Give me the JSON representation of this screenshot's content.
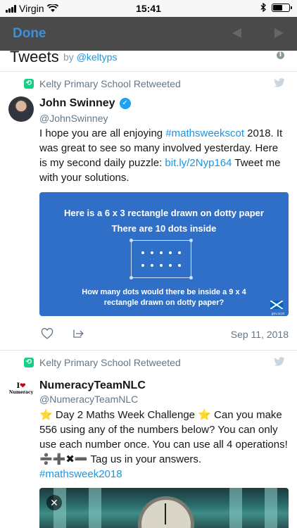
{
  "status_bar": {
    "carrier": "Virgin",
    "time": "15:41",
    "battery_percent": 60
  },
  "nav": {
    "done_label": "Done"
  },
  "widget": {
    "title": "Tweets",
    "by_prefix": "by",
    "by_handle": "@keltyps"
  },
  "tweets": [
    {
      "retweet_label": "Kelty Primary School Retweeted",
      "name": "John Swinney",
      "verified": true,
      "handle": "@JohnSwinney",
      "text_parts": {
        "p1": "I hope you are all enjoying ",
        "hashtag": "#mathsweekscot",
        "p2": " 2018. It was great to see so many involved yesterday. Here is my second daily puzzle: ",
        "link": "bit.ly/2Nyp164",
        "p3": " Tweet me with your solutions."
      },
      "card": {
        "line1": "Here is a 6 x 3 rectangle drawn on dotty paper",
        "line2": "There are 10 dots inside",
        "question1": "How many dots would there be inside a 9 x 4",
        "question2": "rectangle drawn on dotty paper?",
        "flag_label": "gov.scot"
      },
      "date": "Sep 11, 2018"
    },
    {
      "retweet_label": "Kelty Primary School Retweeted",
      "name": "NumeracyTeamNLC",
      "handle": "@NumeracyTeamNLC",
      "avatar_text": {
        "line1": "I",
        "heart": "❤",
        "line2": "Numeracy"
      },
      "text_parts": {
        "star": "⭐",
        "p1": " Day 2 Maths Week Challenge ",
        "p2": " Can you make 556 using any of the numbers below? You can only use each number once. You can use all 4 operations! ",
        "ops": "➗➕✖➖",
        "p3": " Tag us in your answers.",
        "hashtag": "#mathsweek2018"
      },
      "close_label": "✕"
    }
  ],
  "colors": {
    "link": "#1b95e0",
    "retweet": "#19cf86",
    "card_bg": "#2f6fc7",
    "nav_bg": "#4a4a4a"
  },
  "icons": [
    "wifi-icon",
    "bluetooth-icon",
    "battery-icon",
    "info-icon",
    "retweet-icon",
    "twitter-bird-icon",
    "verified-icon",
    "heart-icon",
    "share-icon",
    "close-icon"
  ]
}
